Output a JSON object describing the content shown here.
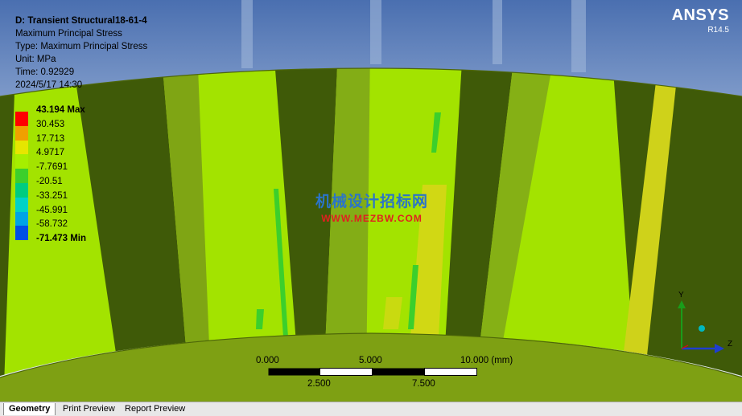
{
  "info": {
    "title": "D: Transient Structural18-61-4",
    "result_name": "Maximum Principal Stress",
    "type": "Type: Maximum Principal Stress",
    "unit": "Unit: MPa",
    "time": "Time: 0.92929",
    "date": "2024/5/17 14:30"
  },
  "logo": {
    "brand": "ANSYS",
    "version": "R14.5"
  },
  "legend": {
    "items": [
      {
        "label": "43.194 Max",
        "color": "#ff0000",
        "bold": true
      },
      {
        "label": "30.453",
        "color": "#f0a000",
        "bold": false
      },
      {
        "label": "17.713",
        "color": "#e6e600",
        "bold": false
      },
      {
        "label": "4.9717",
        "color": "#a6ee00",
        "bold": false
      },
      {
        "label": "-7.7691",
        "color": "#3ccf2c",
        "bold": false
      },
      {
        "label": "-20.51",
        "color": "#00cc80",
        "bold": false
      },
      {
        "label": "-33.251",
        "color": "#00d2c8",
        "bold": false
      },
      {
        "label": "-45.991",
        "color": "#00a4e6",
        "bold": false
      },
      {
        "label": "-58.732",
        "color": "#0050e6",
        "bold": false
      },
      {
        "label": "-71.473 Min",
        "color": "#0000ff",
        "bold": true
      }
    ]
  },
  "watermark": {
    "cn": "机械设计招标网",
    "url": "WWW.MEZBW.COM"
  },
  "scale_bar": {
    "top_labels": [
      "0.000",
      "5.000",
      "10.000 (mm)"
    ],
    "bottom_labels": [
      "2.500",
      "7.500"
    ]
  },
  "axes": {
    "y": "Y",
    "z": "Z"
  },
  "tabs": [
    {
      "label": "Geometry",
      "active": true
    },
    {
      "label": "Print Preview",
      "active": false
    },
    {
      "label": "Report Preview",
      "active": false
    }
  ],
  "colors": {
    "light_band": "#a6ee00",
    "dark_band": "#3f5a08",
    "mid_band": "#7ea413",
    "background_top": "#4a6fb0"
  }
}
